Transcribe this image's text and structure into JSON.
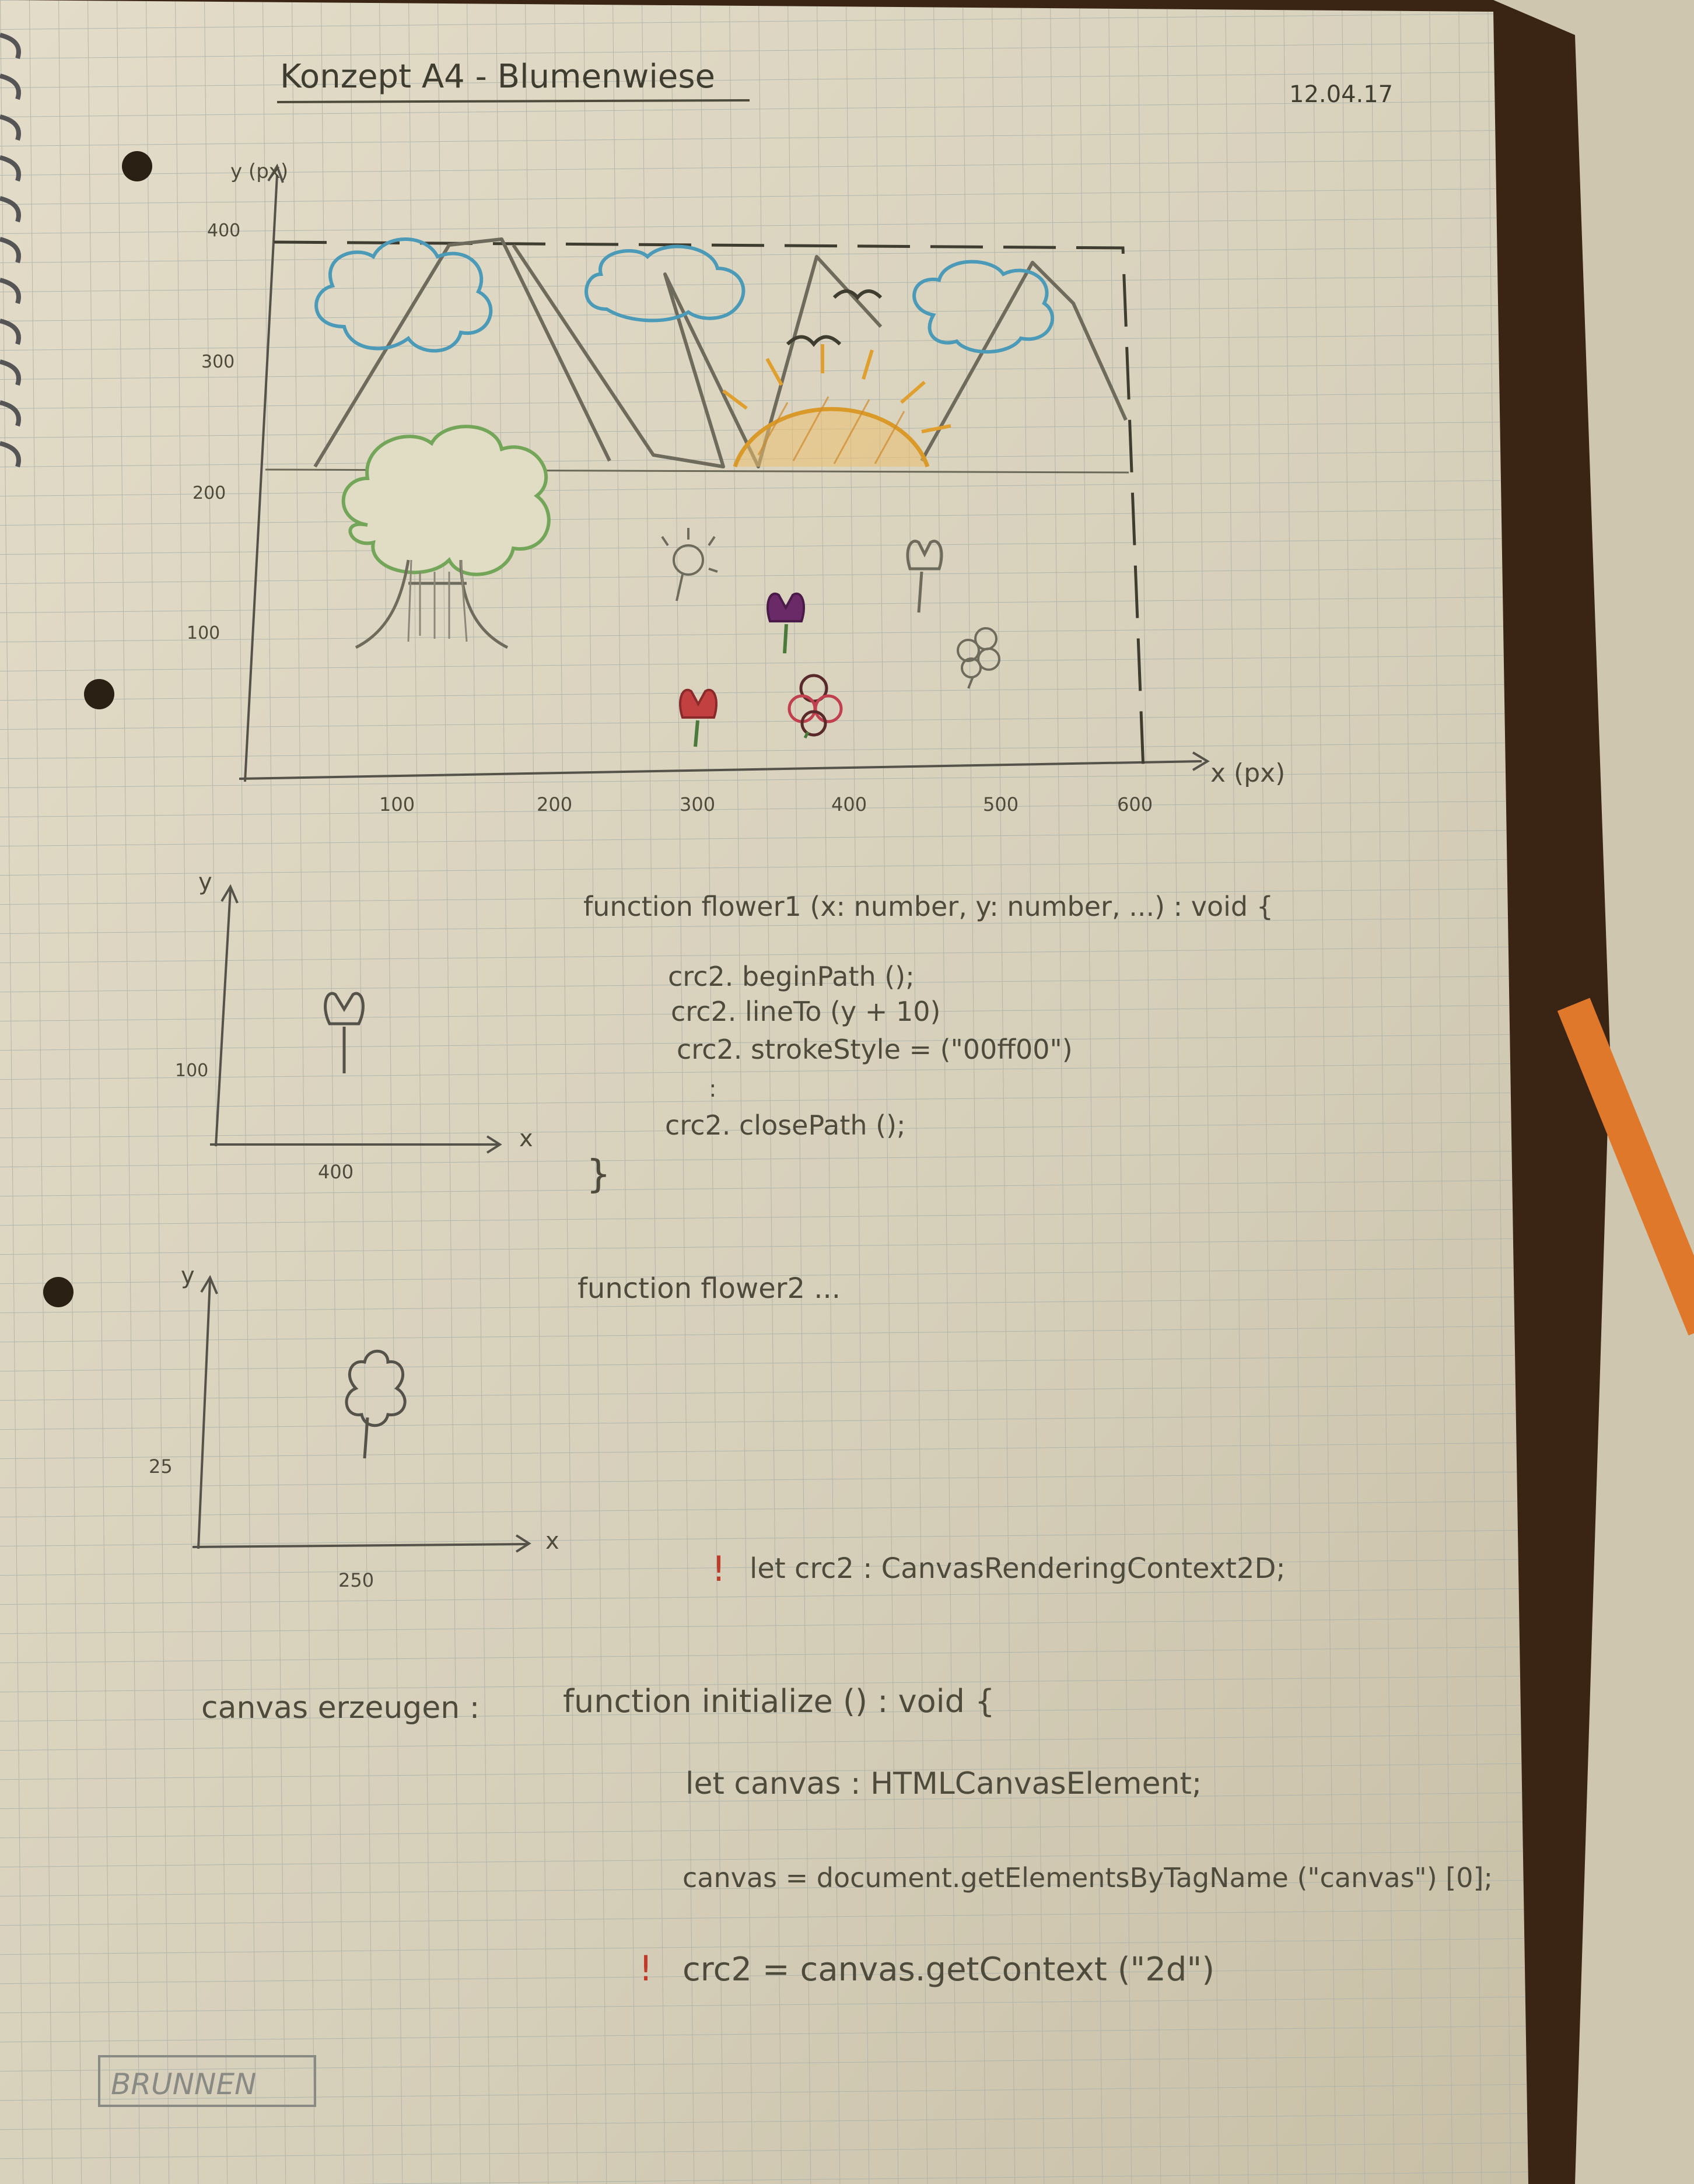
{
  "page": {
    "title": "Konzept A4 - Blumenwiese",
    "date": "12.04.17",
    "brand": "BRUNNEN"
  },
  "main_sketch": {
    "y_axis_label": "y (px)",
    "x_axis_label": "x (px)",
    "y_ticks": [
      "400",
      "300",
      "200",
      "100"
    ],
    "x_ticks": [
      "100",
      "200",
      "300",
      "400",
      "500",
      "600"
    ]
  },
  "sketch_flower1": {
    "y_label": "y",
    "x_label": "x",
    "y_tick": "100",
    "x_tick": "400"
  },
  "sketch_flower2": {
    "y_label": "y",
    "x_label": "x",
    "y_tick": "25",
    "x_tick": "250"
  },
  "code_flower1": {
    "signature": "function flower1 (x: number, y: number, ...) : void {",
    "lines": [
      "crc2. beginPath ();",
      "crc2. lineTo (y + 10)",
      "crc2. strokeStyle = (\"00ff00\")",
      ":",
      "crc2. closePath ();"
    ],
    "closing": "}"
  },
  "code_flower2": {
    "signature": "function flower2 ..."
  },
  "code_crc": {
    "marker": "!",
    "line": "let crc2 : CanvasRenderingContext2D;"
  },
  "code_init": {
    "label": "canvas erzeugen :",
    "signature": "function initialize () : void {",
    "lines": [
      "let canvas : HTMLCanvasElement;",
      "canvas = document.getElementsByTagName (\"canvas\") [0];",
      "crc2 = canvas.getContext (\"2d\")"
    ],
    "marker": "!"
  },
  "colors": {
    "paper": "#d9d1bd",
    "grid": "#a9aea6",
    "pencil": "#4e4b3c",
    "cloud": "#4a9ab8",
    "tree": "#74a65a",
    "sun": "#e0a030",
    "tulip_red": "#c24040",
    "tulip_purple": "#6a2a68",
    "red_marker": "#c03a2a"
  }
}
